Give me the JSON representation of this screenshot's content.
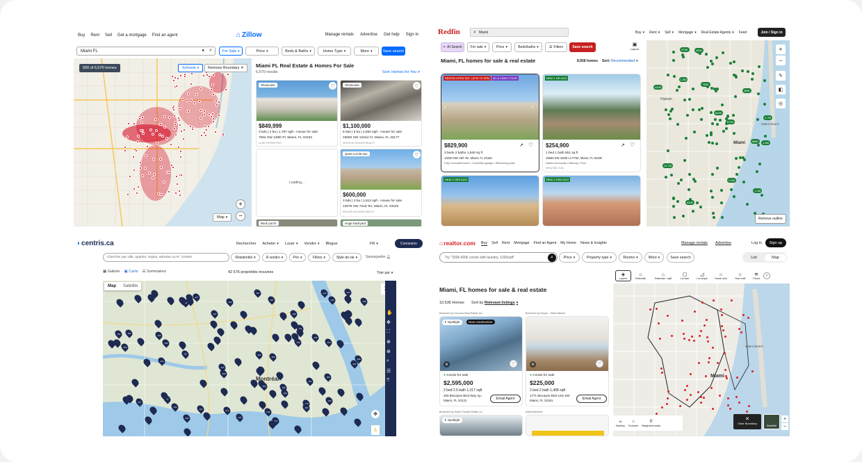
{
  "zillow": {
    "nav_left": [
      "Buy",
      "Rent",
      "Sell",
      "Get a mortgage",
      "Find an agent"
    ],
    "logo": "Zillow",
    "nav_right": [
      "Manage rentals",
      "Advertise",
      "Get help",
      "Sign in"
    ],
    "search_value": "Miami FL",
    "filters": [
      "For Sale",
      "Price",
      "Beds & Baths",
      "Home Type",
      "More"
    ],
    "save_search": "Save search",
    "map_count": "500 of 6,570 homes",
    "schools": "Schools",
    "remove_boundary": "Remove Boundary",
    "map_label": "Map",
    "title": "Miami FL Real Estate & Homes For Sale",
    "results": "6,570 results",
    "sort": "Sort: Homes for You",
    "loading": "Loading...",
    "listings": [
      {
        "badge": "Showcase",
        "price": "$849,999",
        "facts": "3 bds | 2 ba | 1,787 sqft - House for sale",
        "address": "7004 SW 139th Pl, Miami, FL 33183",
        "broker": "LUXE PROPERTIES"
      },
      {
        "badge": "Showcase",
        "price": "$1,100,000",
        "facts": "5 bds | 5 ba | 2,850 sqft - House for sale",
        "address": "19550 SW 132nd Ct, Miami, FL 33177",
        "broker": "VERTICAL SPACES REALTY"
      },
      {
        "badge": "Quiet cul-de-sac",
        "price": "$600,000",
        "facts": "3 bds | 2 ba | 1,612 sqft - House for sale",
        "address": "13675 SW 72nd Ter, Miami, FL 33183",
        "broker": "KELLER WILLIAMS REALTY"
      }
    ],
    "bottom_badges": [
      "Back porch",
      "Huge backyard"
    ]
  },
  "redfin": {
    "logo": "Redfin",
    "search_value": "Miami",
    "nav": [
      "Buy",
      "Rent",
      "Sell",
      "Mortgage",
      "Real Estate Agents",
      "Feed"
    ],
    "join": "Join / Sign in",
    "ai_search": "AI Search",
    "filters": [
      "For sale",
      "Price",
      "Beds/baths",
      "Filters"
    ],
    "save_search": "Save search",
    "layout": "Layout",
    "title": "Miami, FL homes for sale & real estate",
    "count": "8,958 homes",
    "sort_label": "Sort:",
    "sort_value": "Recommended",
    "listings": [
      {
        "tag": "REDFIN OPEN SAT, 12PM TO 3PM",
        "tag2": "3D & VIDEO TOUR",
        "price": "$829,900",
        "facts": "3 beds  2 baths  1,940 sq ft",
        "address": "13230 NW 11th Ter, Miami, FL 33182",
        "desc": "Fully renovated home • Converted garage • Welcoming patio"
      },
      {
        "tag": "NEW 1 HR AGO",
        "price": "$254,900",
        "facts": "1 bed  1 bath  651 sq ft",
        "address": "15655 SW 106th Ln #702, Miami, FL 33196",
        "desc": "Gated community • Balcony • Pool",
        "phone": "(954) 330-7151"
      }
    ],
    "bottom_tags": [
      "NEW 2 HRS AGO",
      "NEW 2 HRS AGO"
    ],
    "remove_outline": "Remove outline",
    "map_prices": [
      "1.8M",
      "1.9M",
      "499K",
      "750K",
      "1.5M",
      "849K",
      "629K",
      "1.1M",
      "1.7M",
      "675K",
      "429K",
      "575K",
      "13.7M",
      "589K",
      "400K"
    ],
    "place_labels": [
      "Hialeah",
      "Miami",
      "Miami Beach"
    ]
  },
  "centris": {
    "logo": "centris.ca",
    "nav": [
      "Rechercher",
      "Acheter",
      "Louer",
      "Vendre",
      "Blogue"
    ],
    "lang": "FR",
    "connexion": "Connexion",
    "search_placeholder": "Chercher par ville, quartier, région, adresse ou N° Centris",
    "filters": [
      "Résidentiel",
      "À vendre",
      "Prix",
      "Filtres",
      "Style de vie"
    ],
    "save": "Sauvegarder",
    "views": [
      "Galerie",
      "Carte",
      "Sommaires"
    ],
    "count": "42 676 propriétés trouvées",
    "sort": "Trier par",
    "map_tabs": [
      "Map",
      "Satellite"
    ],
    "city": "Montréal",
    "pin_numbers": [
      "177",
      "121",
      "97",
      "103",
      "139",
      "149",
      "110",
      "83",
      "209",
      "141",
      "117",
      "131",
      "170",
      "162",
      "145",
      "141",
      "163",
      "140",
      "119",
      "126",
      "179",
      "160",
      "118",
      "100",
      "150",
      "112",
      "161",
      "105",
      "123",
      "147",
      "136",
      "141",
      "138",
      "112",
      "117",
      "171",
      "110",
      "164",
      "128",
      "108",
      "163",
      "119",
      "135",
      "126",
      "116",
      "156"
    ]
  },
  "realtor": {
    "logo": "realtor.com",
    "nav": [
      "Buy",
      "Sell",
      "Rent",
      "Mortgage",
      "Find an Agent",
      "My Home",
      "News & Insights"
    ],
    "nav_right": [
      "Manage rentals",
      "Advertise",
      "Log in"
    ],
    "sign_up": "Sign up",
    "search_placeholder": "Try \"300k-600k condo with laundry, 1200sqft\"",
    "filters": [
      "Price",
      "Property type",
      "Rooms",
      "More"
    ],
    "save_search": "Save search",
    "toggle": [
      "List",
      "Map"
    ],
    "title": "Miami, FL homes for sale & real estate",
    "count": "10,536 Homes",
    "sort_label": "Sort by",
    "sort_value": "Relevant listings",
    "listings": [
      {
        "brokered": "Brokered by Cervera Real Estate Inc",
        "badges": [
          "Spotlight",
          "New construction"
        ],
        "type": "Condo for sale",
        "price": "$2,595,000",
        "facts": "2 bed  2.5 bath  1,317 sqft",
        "address1": "300 Biscayne Blvd Way Ap...",
        "address2": "Miami, FL 33131",
        "cta": "Email Agent"
      },
      {
        "brokered": "Brokered by Keyes - Miami Beach",
        "type": "Condo for sale",
        "price": "$225,000",
        "facts": "2 bed  2 bath  1,408 sqft",
        "address1": "1771 Biscayne Blvd Unit 160",
        "address2": "Miami, FL 33181",
        "cta": "Email Agent"
      }
    ],
    "bottom_brokered": "Brokered by South Florida Realty Llc",
    "bottom_badge": "Spotlight",
    "advertisement": "Advertisement",
    "map_tools": [
      "Layers",
      "Estimate",
      "Estimate / sqft",
      "Lot size",
      "Lot slope",
      "Home size",
      "Year built",
      "Flood"
    ],
    "map_bottom": [
      "Nearby",
      "Schools",
      "Neighborhoods"
    ],
    "clear_boundary": "Clear Boundary",
    "satellite": "Satellite",
    "place_labels": [
      "Miami",
      "Miami Beach"
    ]
  },
  "colors": {
    "zillow_blue": "#006aff",
    "redfin_red": "#c82021",
    "redfin_green": "#1a7f37",
    "centris_navy": "#1d2a52",
    "realtor_red": "#d92228",
    "zillow_pin": "#d4001b"
  }
}
